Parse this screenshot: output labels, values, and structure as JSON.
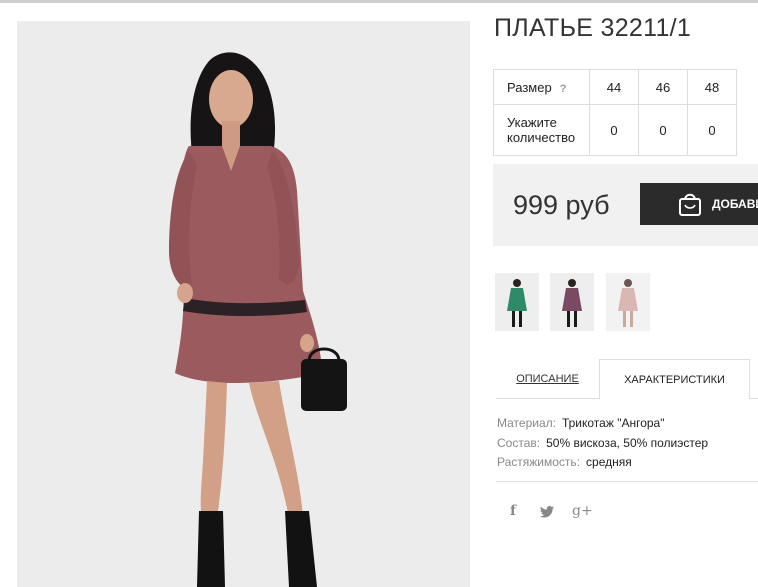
{
  "product": {
    "title": "ПЛАТЬЕ 32211/1"
  },
  "size_table": {
    "size_label": "Размер",
    "help_glyph": "?",
    "sizes": [
      "44",
      "46",
      "48"
    ],
    "qty_label_line1": "Укажите",
    "qty_label_line2": "количество",
    "quantities": [
      "0",
      "0",
      "0"
    ]
  },
  "purchase": {
    "price": "999 руб",
    "add_label": "ДОБАВИ"
  },
  "tabs": {
    "description": "ОПИСАНИЕ",
    "characteristics": "ХАРАКТЕРИСТИКИ"
  },
  "characteristics": [
    {
      "key": "Материал:",
      "value": "Трикотаж \"Ангора\""
    },
    {
      "key": "Состав:",
      "value": "50% вискоза, 50% полиэстер"
    },
    {
      "key": "Растяжимость:",
      "value": "средняя"
    }
  ],
  "social": {
    "facebook": "f",
    "twitter": "twitter-icon",
    "googleplus": "g+"
  },
  "colors": {
    "dress_main": "#9a5a5e",
    "thumb_green": "#2f8a6a",
    "thumb_plum": "#7a4a63",
    "thumb_pink": "#d9b7b2",
    "button_bg": "#2b2b2b"
  }
}
